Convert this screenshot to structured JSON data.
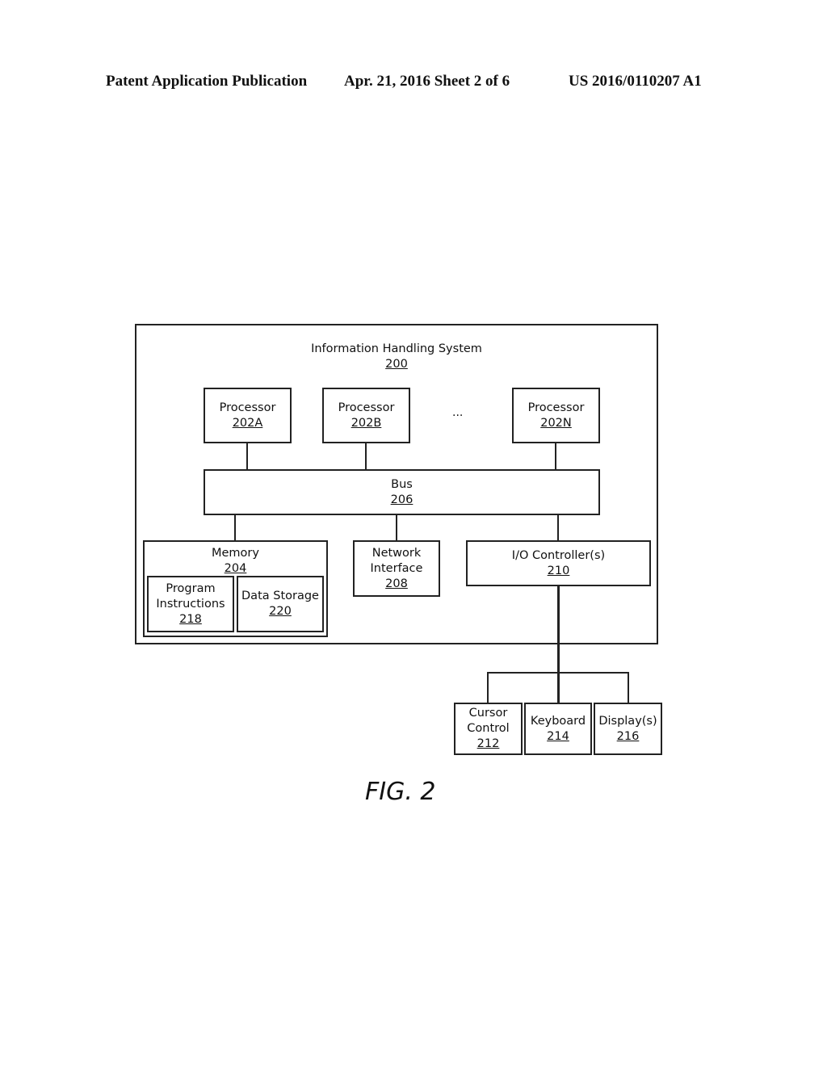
{
  "header": {
    "publication": "Patent Application Publication",
    "date_sheet": "Apr. 21, 2016  Sheet 2 of 6",
    "number": "US 2016/0110207 A1"
  },
  "diagram": {
    "system": {
      "label": "Information Handling System",
      "ref": "200"
    },
    "processors": [
      {
        "label": "Processor",
        "ref": "202A"
      },
      {
        "label": "Processor",
        "ref": "202B"
      },
      {
        "label": "Processor",
        "ref": "202N"
      }
    ],
    "ellipsis": "...",
    "bus": {
      "label": "Bus",
      "ref": "206"
    },
    "memory": {
      "label": "Memory",
      "ref": "204"
    },
    "program_instructions": {
      "label1": "Program",
      "label2": "Instructions",
      "ref": "218"
    },
    "data_storage": {
      "label": "Data Storage",
      "ref": "220"
    },
    "network_interface": {
      "label1": "Network",
      "label2": "Interface",
      "ref": "208"
    },
    "io_controller": {
      "label": "I/O Controller(s)",
      "ref": "210"
    },
    "cursor_control": {
      "label1": "Cursor",
      "label2": "Control",
      "ref": "212"
    },
    "keyboard": {
      "label": "Keyboard",
      "ref": "214"
    },
    "display": {
      "label": "Display(s)",
      "ref": "216"
    }
  },
  "figure_label": "FIG. 2"
}
